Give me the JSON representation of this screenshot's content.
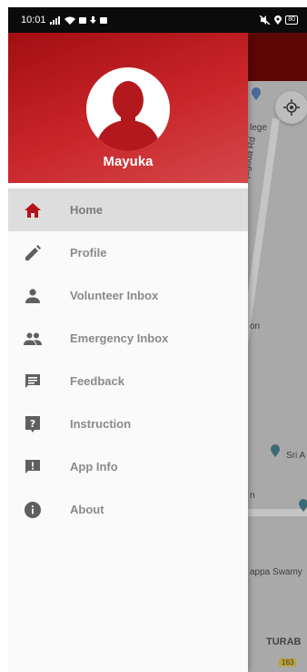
{
  "status_bar": {
    "time": "10:01",
    "battery": "80"
  },
  "colors": {
    "accent": "#c21f24",
    "active_icon": "#b5121b",
    "icon": "#5f5f5f"
  },
  "drawer": {
    "profile_name": "Mayuka",
    "menu": [
      {
        "label": "Home",
        "icon": "home-icon",
        "active": true
      },
      {
        "label": "Profile",
        "icon": "pencil-icon"
      },
      {
        "label": "Volunteer Inbox",
        "icon": "person-icon"
      },
      {
        "label": "Emergency Inbox",
        "icon": "people-icon"
      },
      {
        "label": "Feedback",
        "icon": "feedback-icon"
      },
      {
        "label": "Instruction",
        "icon": "help-icon"
      },
      {
        "label": "App Info",
        "icon": "alert-icon"
      },
      {
        "label": "About",
        "icon": "info-icon"
      }
    ]
  },
  "map": {
    "labels": {
      "college": "lege",
      "road": "Rajaguda Rd",
      "on": "on",
      "sri": "Sri A",
      "n": "n",
      "swamy": "appa Swamy",
      "turab": "TURAB",
      "route": "163"
    }
  }
}
